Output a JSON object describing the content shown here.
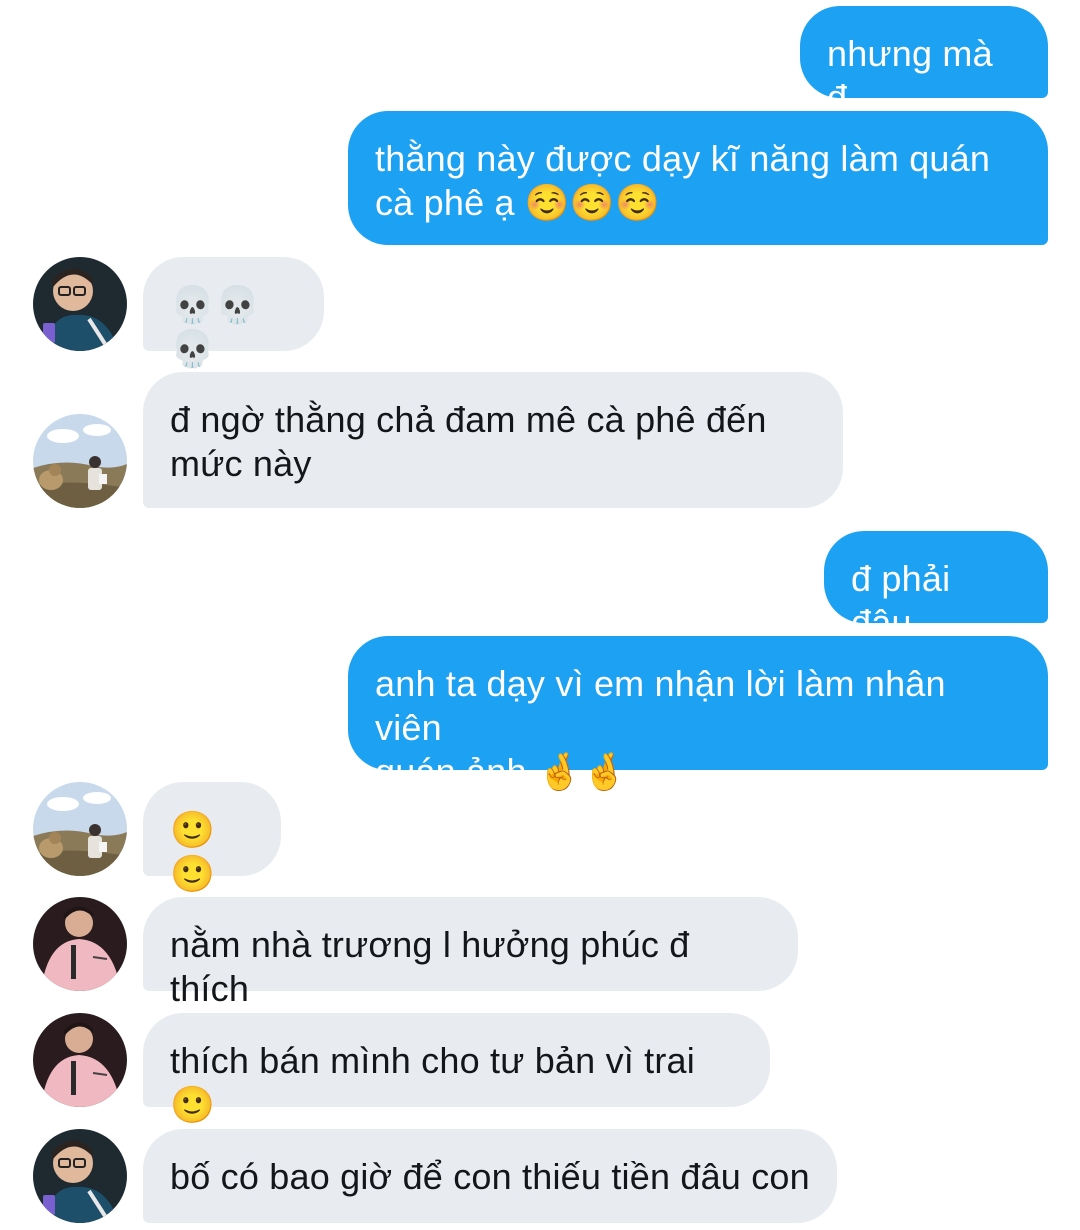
{
  "messages": [
    {
      "direction": "outgoing",
      "text": "nhưng mà đ"
    },
    {
      "direction": "outgoing",
      "text": "thằng này được dạy kĩ năng làm quán\ncà phê ạ ☺️☺️☺️"
    },
    {
      "direction": "incoming",
      "avatar": "avatar-glasses-icon",
      "text": "💀💀💀"
    },
    {
      "direction": "incoming",
      "avatar": "avatar-landscape-icon",
      "text": "đ ngờ thằng chả đam mê cà phê đến\nmức này"
    },
    {
      "direction": "outgoing",
      "text": "đ phải đâu"
    },
    {
      "direction": "outgoing",
      "text": "anh ta dạy vì em nhận lời làm nhân viên\nquán ảnh 🤞🤞"
    },
    {
      "direction": "incoming",
      "avatar": "avatar-landscape-icon",
      "text": "🙂🙂"
    },
    {
      "direction": "incoming",
      "avatar": "avatar-pink-jacket-icon",
      "text": "nằm nhà trương l hưởng phúc đ thích"
    },
    {
      "direction": "incoming",
      "avatar": "avatar-pink-jacket-icon",
      "text": "thích bán mình cho tư bản vì trai 🙂"
    },
    {
      "direction": "incoming",
      "avatar": "avatar-glasses-icon",
      "text": "bố có bao giờ để con thiếu tiền đâu con"
    }
  ],
  "colors": {
    "outgoing_bubble": "#1da1f2",
    "incoming_bubble": "#e8ecf0",
    "outgoing_text": "#ffffff",
    "incoming_text": "#14171a"
  }
}
